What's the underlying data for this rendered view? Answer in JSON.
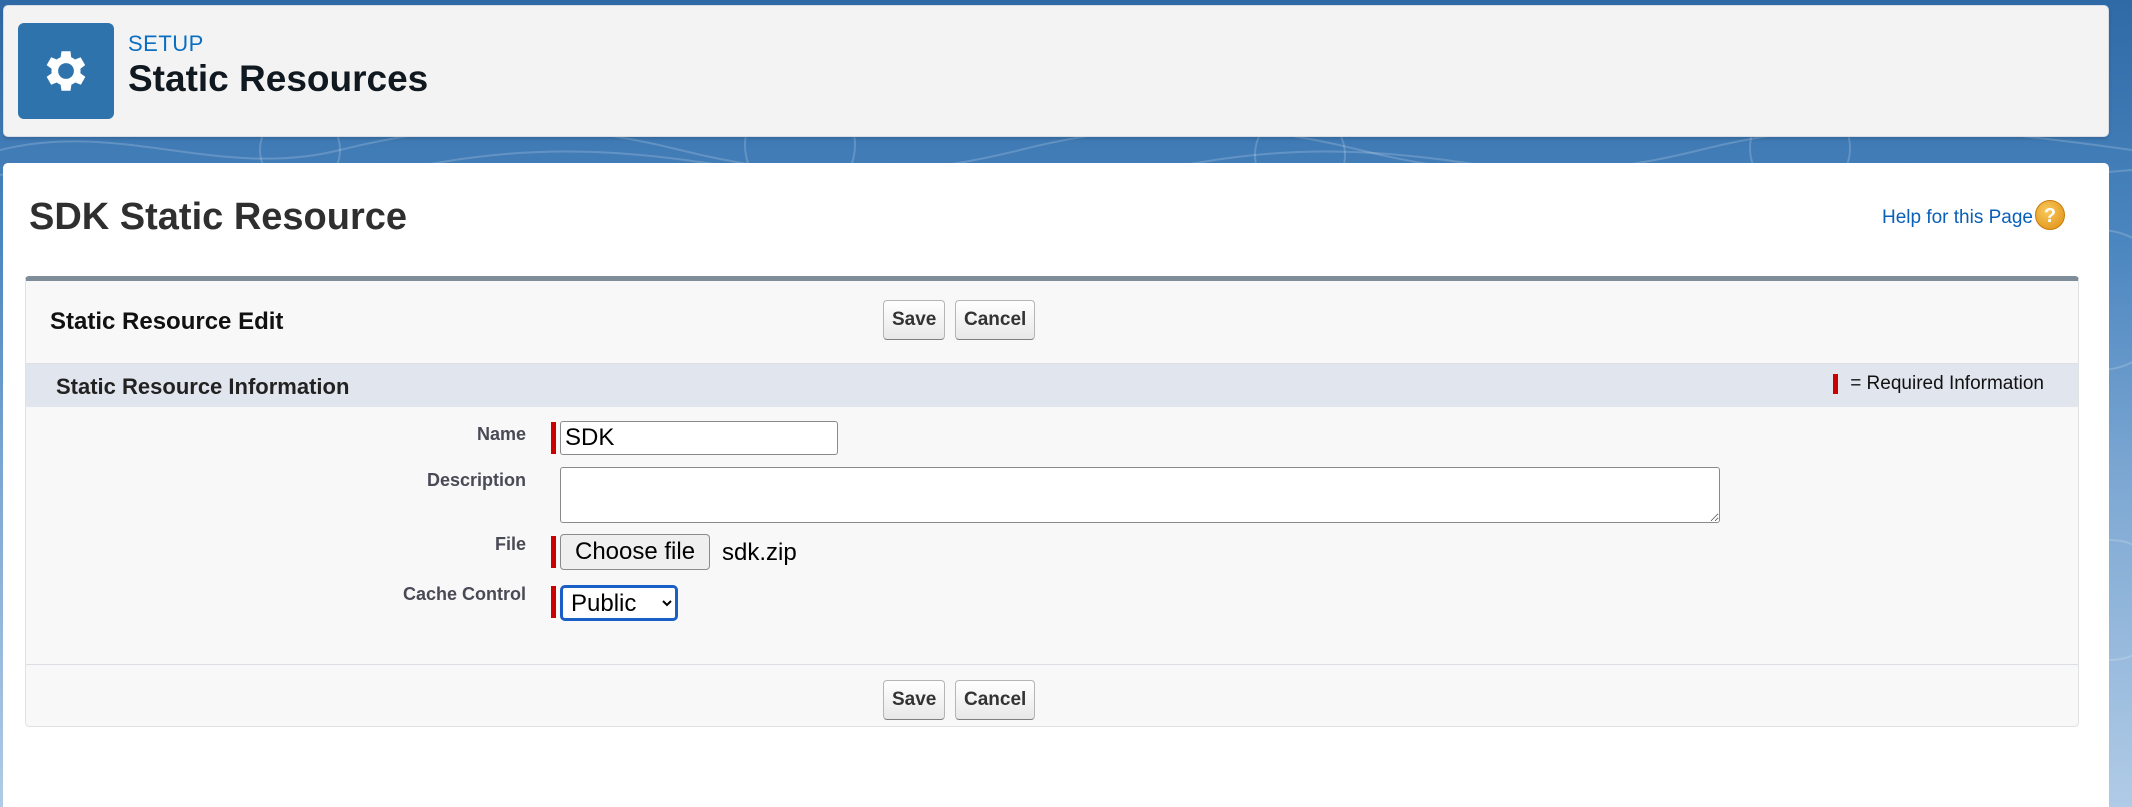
{
  "header": {
    "breadcrumb": "SETUP",
    "title": "Static Resources",
    "icon": "gear-icon"
  },
  "page": {
    "title": "SDK Static Resource",
    "help_link": "Help for this Page",
    "help_icon_glyph": "?"
  },
  "edit_block": {
    "title": "Static Resource Edit",
    "save_label": "Save",
    "cancel_label": "Cancel"
  },
  "section": {
    "title": "Static Resource Information",
    "required_legend": "= Required Information"
  },
  "fields": {
    "name": {
      "label": "Name",
      "value": "SDK"
    },
    "description": {
      "label": "Description",
      "value": ""
    },
    "file": {
      "label": "File",
      "button_label": "Choose file",
      "file_name": "sdk.zip"
    },
    "cache_control": {
      "label": "Cache Control",
      "selected": "Public",
      "options": [
        "Public"
      ]
    }
  },
  "colors": {
    "accent": "#2e73ab",
    "link": "#0a5fb8",
    "required": "#cc0000"
  }
}
